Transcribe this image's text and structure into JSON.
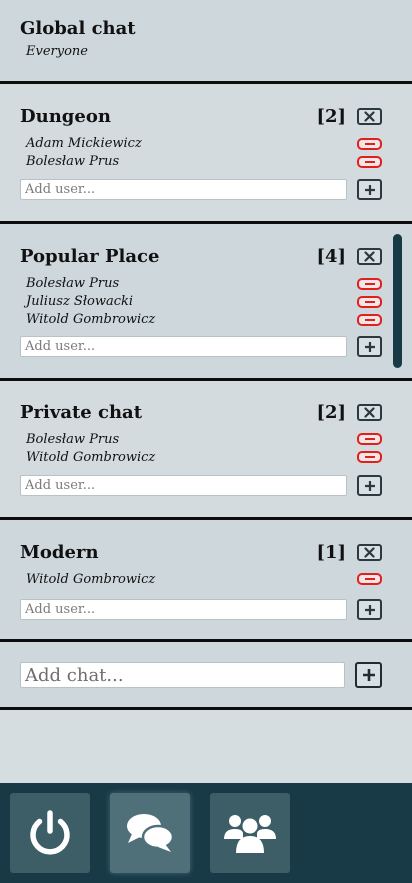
{
  "global_chat": {
    "title": "Global chat",
    "subtitle": "Everyone"
  },
  "chats": [
    {
      "name": "Dungeon",
      "count": "[2]",
      "members": [
        "Adam Mickiewicz",
        "Bolesław Prus"
      ],
      "add_placeholder": "Add user..."
    },
    {
      "name": "Popular Place",
      "count": "[4]",
      "members": [
        "Bolesław Prus",
        "Juliusz Słowacki",
        "Witold Gombrowicz"
      ],
      "add_placeholder": "Add user..."
    },
    {
      "name": "Private chat",
      "count": "[2]",
      "members": [
        "Bolesław Prus",
        "Witold Gombrowicz"
      ],
      "add_placeholder": "Add user..."
    },
    {
      "name": "Modern",
      "count": "[1]",
      "members": [
        "Witold Gombrowicz"
      ],
      "add_placeholder": "Add user..."
    }
  ],
  "add_chat": {
    "placeholder": "Add chat..."
  },
  "icons": {
    "close": "close-icon",
    "remove": "minus-icon",
    "add": "plus-icon",
    "power": "power-icon",
    "chats": "chat-bubbles-icon",
    "users": "users-icon"
  },
  "colors": {
    "nav_background": "#183a46",
    "remove_accent": "#e0201d",
    "card_background": "#cdd7dc",
    "separator": "#0d0d0d"
  }
}
